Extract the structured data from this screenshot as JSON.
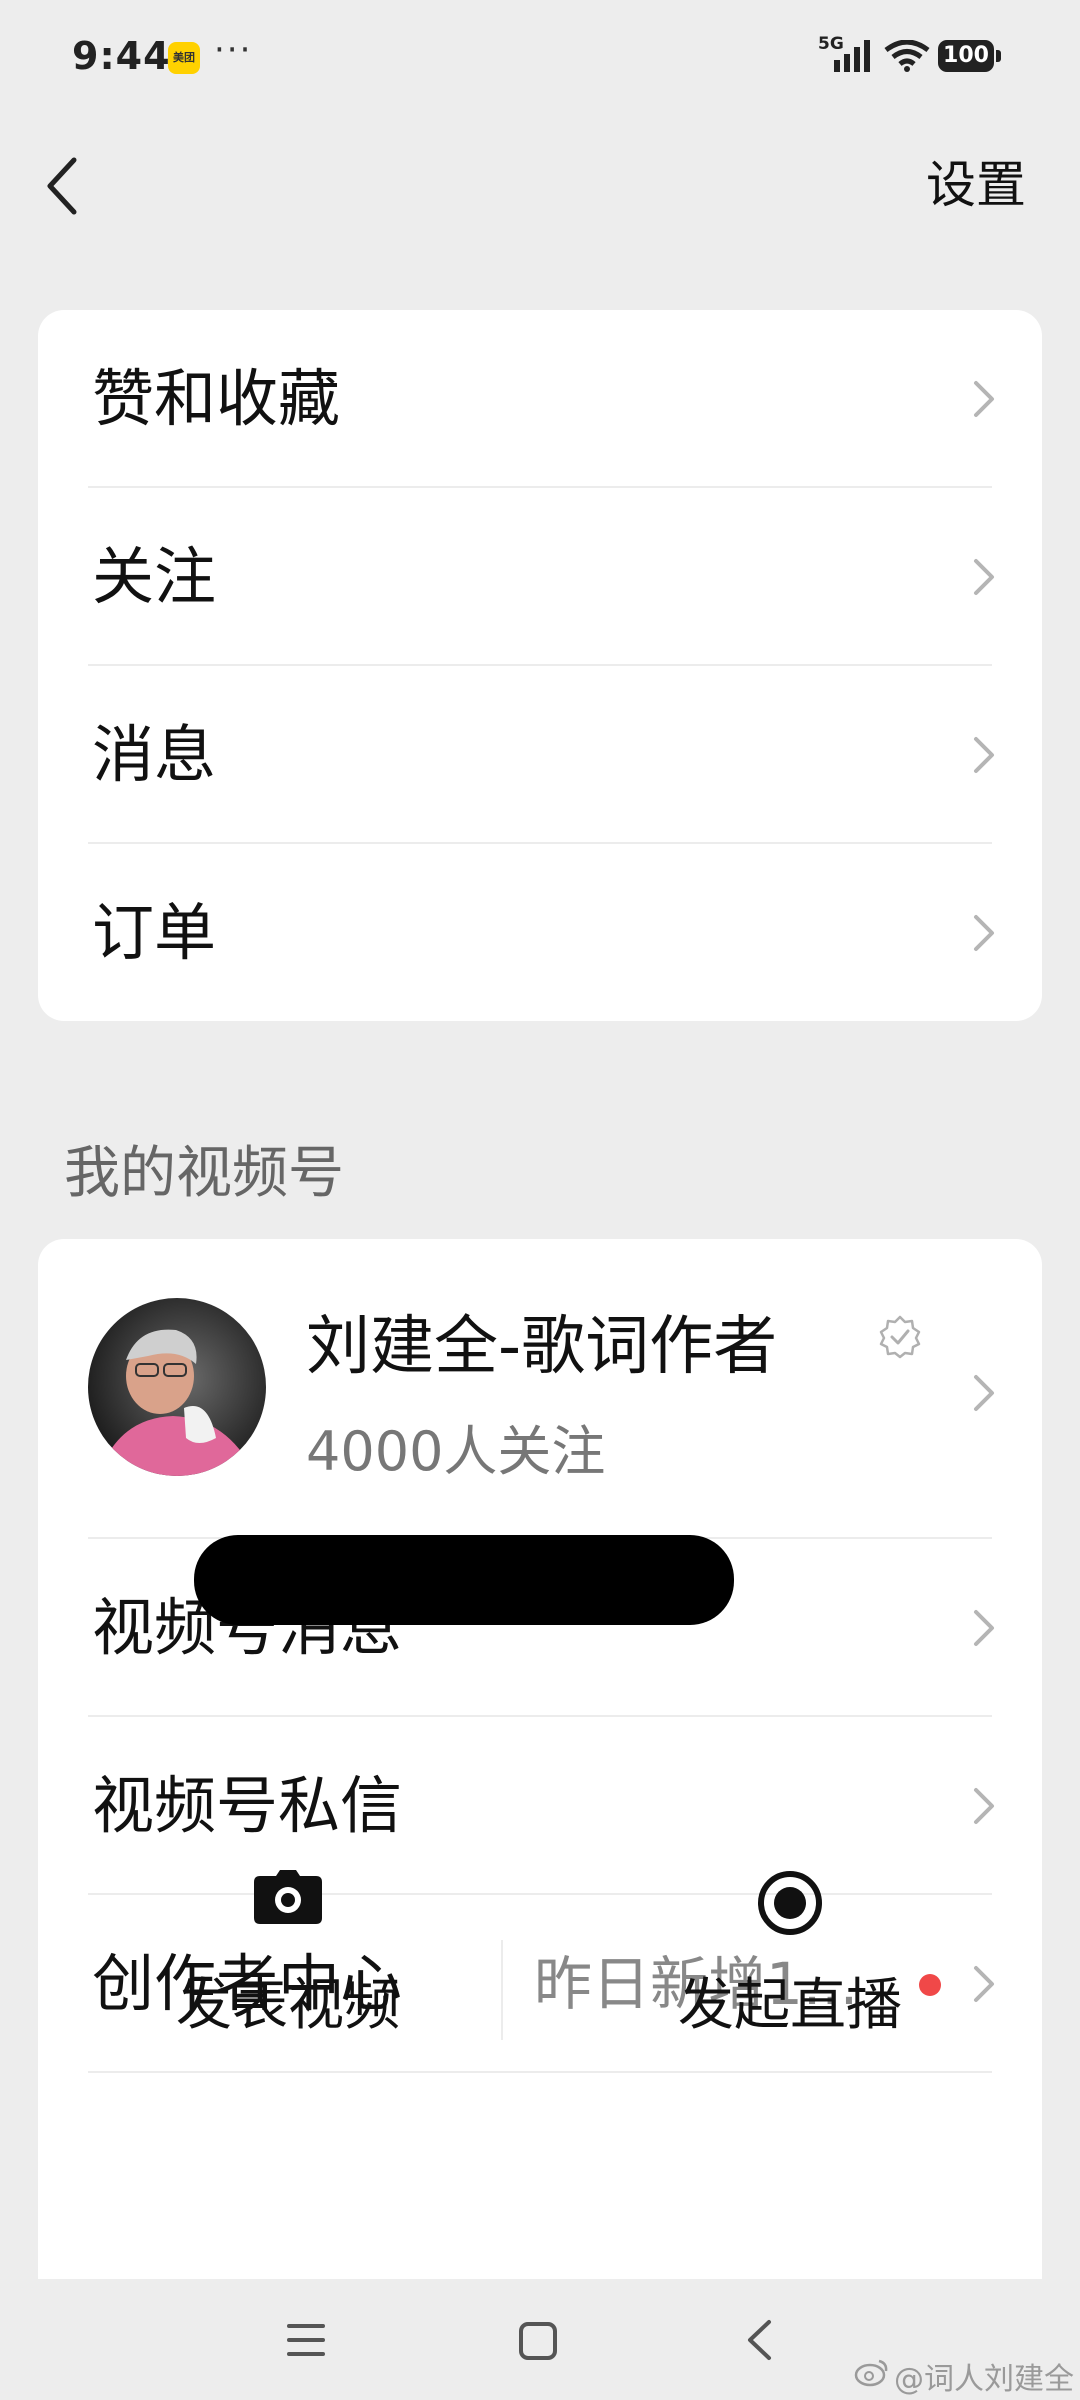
{
  "status_bar": {
    "time": "9:44",
    "app_badge": "美团",
    "more": "···",
    "network": "5G",
    "battery": "100",
    "icons": [
      "meituan-icon",
      "signal-icon",
      "wifi-icon",
      "battery-icon"
    ]
  },
  "nav": {
    "back_icon": "chevron-left-icon",
    "settings_label": "设置"
  },
  "menu_card": {
    "items": [
      {
        "label": "赞和收藏"
      },
      {
        "label": "关注"
      },
      {
        "label": "消息"
      },
      {
        "label": "订单"
      }
    ]
  },
  "channels_section": {
    "title": "我的视频号",
    "profile": {
      "name": "刘建全-歌词作者",
      "followers": "4000人关注",
      "verified_icon": "verified-badge-icon"
    },
    "items": [
      {
        "label": "视频号消息"
      },
      {
        "label": "视频号私信"
      },
      {
        "label": "创作者中心",
        "hint": "昨日新增1..."
      }
    ],
    "actions": [
      {
        "label": "发表视频",
        "icon": "camera-icon"
      },
      {
        "label": "发起直播",
        "icon": "live-record-icon"
      }
    ]
  },
  "system_nav": {
    "icons": [
      "menu-icon",
      "home-icon",
      "back-icon"
    ],
    "watermark": "@词人刘建全"
  },
  "colors": {
    "background": "#ededed",
    "card": "#ffffff",
    "notification_dot": "#f04848",
    "meituan_yellow": "#ffd100"
  }
}
